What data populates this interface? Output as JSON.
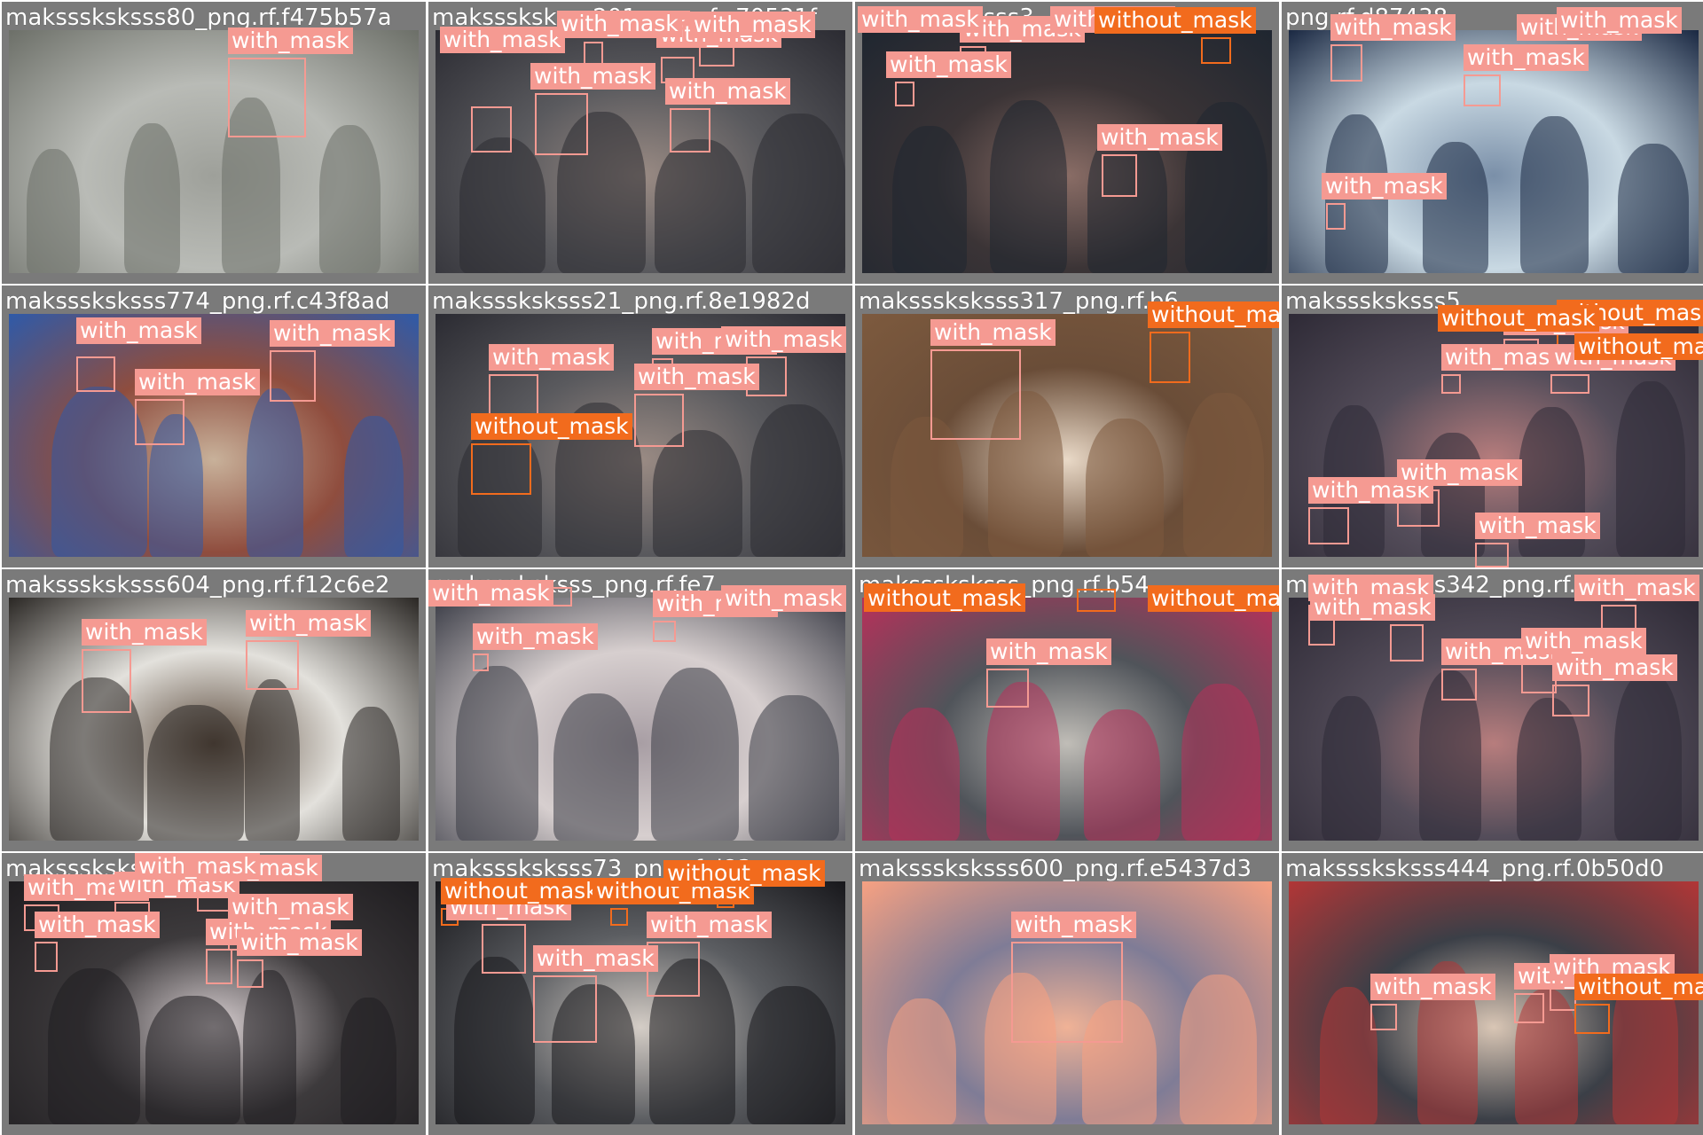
{
  "mosaic": {
    "title_color": "#ffffff",
    "colors": {
      "with_mask": "#f59a92",
      "without_mask": "#f26b1d",
      "frame": "#7a7a7a"
    },
    "cells": [
      {
        "title": "maksssksksss80_png.rf.f475b57a",
        "scene": "street",
        "detections": [
          {
            "label": "with_mask",
            "class": "with_mask"
          }
        ]
      },
      {
        "title": "maksssksksss201_png.rf.c70531f",
        "scene": "crowd",
        "detections": [
          {
            "label": "with_mask",
            "class": "with_mask"
          },
          {
            "label": "with_mask",
            "class": "with_mask"
          },
          {
            "label": "with_mask",
            "class": "with_mask"
          },
          {
            "label": "with_mask",
            "class": "with_mask"
          },
          {
            "label": "with_mask",
            "class": "with_mask"
          },
          {
            "label": "with_mask",
            "class": "with_mask"
          },
          {
            "label": "with_mask",
            "class": "with_mask"
          }
        ]
      },
      {
        "title": "maksssksksss3",
        "scene": "hallway",
        "detections": [
          {
            "label": "with_mask",
            "class": "with_mask"
          },
          {
            "label": "with_mask",
            "class": "with_mask"
          },
          {
            "label": "with_mask",
            "class": "with_mask"
          },
          {
            "label": "with_mask",
            "class": "with_mask"
          },
          {
            "label": "with_mask",
            "class": "with_mask"
          },
          {
            "label": "without_mask",
            "class": "without_mask"
          }
        ]
      },
      {
        "title": "png.rf.d87438",
        "scene": "airport-staff",
        "detections": [
          {
            "label": "with_mask",
            "class": "with_mask"
          },
          {
            "label": "with_mask",
            "class": "with_mask"
          },
          {
            "label": "with_mask",
            "class": "with_mask"
          },
          {
            "label": "with_mask",
            "class": "with_mask"
          },
          {
            "label": "with_mask",
            "class": "with_mask"
          }
        ]
      },
      {
        "title": "maksssksksss774_png.rf.c43f8ad",
        "scene": "children",
        "detections": [
          {
            "label": "with_mask",
            "class": "with_mask"
          },
          {
            "label": "with_mask",
            "class": "with_mask"
          },
          {
            "label": "with_mask",
            "class": "with_mask"
          }
        ]
      },
      {
        "title": "maksssksksss21_png.rf.8e1982d",
        "scene": "crowd",
        "detections": [
          {
            "label": "with_mask",
            "class": "with_mask"
          },
          {
            "label": "with_mask",
            "class": "with_mask"
          },
          {
            "label": "with_mask",
            "class": "with_mask"
          },
          {
            "label": "with_mask",
            "class": "with_mask"
          },
          {
            "label": "without_mask",
            "class": "without_mask"
          }
        ]
      },
      {
        "title": "maksssksksss317_png.rf.b6",
        "scene": "portrait",
        "detections": [
          {
            "label": "with_mask",
            "class": "with_mask"
          },
          {
            "label": "without_mask",
            "class": "without_mask"
          }
        ]
      },
      {
        "title": "maksssksksss5",
        "scene": "dense-crowd",
        "detections": [
          {
            "label": "with_mask",
            "class": "with_mask"
          },
          {
            "label": "with_mask",
            "class": "with_mask"
          },
          {
            "label": "with_mask",
            "class": "with_mask"
          },
          {
            "label": "with_mask",
            "class": "with_mask"
          },
          {
            "label": "with_mask",
            "class": "with_mask"
          },
          {
            "label": "with_mask",
            "class": "with_mask"
          },
          {
            "label": "without_mask",
            "class": "without_mask"
          },
          {
            "label": "without_mask",
            "class": "without_mask"
          },
          {
            "label": "without_mask",
            "class": "without_mask"
          }
        ]
      },
      {
        "title": "maksssksksss604_png.rf.f12c6e2",
        "scene": "soldiers",
        "detections": [
          {
            "label": "with_mask",
            "class": "with_mask"
          },
          {
            "label": "with_mask",
            "class": "with_mask"
          }
        ]
      },
      {
        "title": "maksssksksss_png.rf.fe7",
        "scene": "airport",
        "detections": [
          {
            "label": "with_mask",
            "class": "with_mask"
          },
          {
            "label": "with_mask",
            "class": "with_mask"
          },
          {
            "label": "with_mask",
            "class": "with_mask"
          },
          {
            "label": "with_mask",
            "class": "with_mask"
          }
        ]
      },
      {
        "title": "maksssksksss_png.rf.b54",
        "scene": "crosswalk",
        "detections": [
          {
            "label": "with_mask",
            "class": "with_mask"
          },
          {
            "label": "without_mask",
            "class": "without_mask"
          },
          {
            "label": "without_mask",
            "class": "without_mask"
          },
          {
            "label": "without_mask",
            "class": "without_mask"
          }
        ]
      },
      {
        "title": "maksssksksss342_png.rf.ecd3b6",
        "scene": "dense-crowd",
        "detections": [
          {
            "label": "with_mask",
            "class": "with_mask"
          },
          {
            "label": "with_mask",
            "class": "with_mask"
          },
          {
            "label": "with_mask",
            "class": "with_mask"
          },
          {
            "label": "with_mask",
            "class": "with_mask"
          },
          {
            "label": "with_mask",
            "class": "with_mask"
          },
          {
            "label": "with_mask",
            "class": "with_mask"
          },
          {
            "label": "with_mask",
            "class": "with_mask"
          }
        ]
      },
      {
        "title": "maksssksksss_png.rf.2d7",
        "scene": "queue",
        "detections": [
          {
            "label": "with_mask",
            "class": "with_mask"
          },
          {
            "label": "with_mask",
            "class": "with_mask"
          },
          {
            "label": "with_mask",
            "class": "with_mask"
          },
          {
            "label": "with_mask",
            "class": "with_mask"
          },
          {
            "label": "with_mask",
            "class": "with_mask"
          },
          {
            "label": "with_mask",
            "class": "with_mask"
          },
          {
            "label": "with_mask",
            "class": "with_mask"
          },
          {
            "label": "with_mask",
            "class": "with_mask"
          }
        ]
      },
      {
        "title": "maksssksksss73_png.rf.d83",
        "scene": "phones",
        "detections": [
          {
            "label": "with_mask",
            "class": "with_mask"
          },
          {
            "label": "with_mask",
            "class": "with_mask"
          },
          {
            "label": "with_mask",
            "class": "with_mask"
          },
          {
            "label": "without_mask",
            "class": "without_mask"
          },
          {
            "label": "without_mask",
            "class": "without_mask"
          },
          {
            "label": "without_mask",
            "class": "without_mask"
          }
        ]
      },
      {
        "title": "maksssksksss600_png.rf.e5437d3",
        "scene": "headshot",
        "detections": [
          {
            "label": "with_mask",
            "class": "with_mask"
          }
        ]
      },
      {
        "title": "maksssksksss444_png.rf.0b50d0",
        "scene": "arrivals",
        "detections": [
          {
            "label": "with_mask",
            "class": "with_mask"
          },
          {
            "label": "with_mask",
            "class": "with_mask"
          },
          {
            "label": "with_mask",
            "class": "with_mask"
          },
          {
            "label": "without_mask",
            "class": "without_mask"
          }
        ]
      }
    ]
  }
}
